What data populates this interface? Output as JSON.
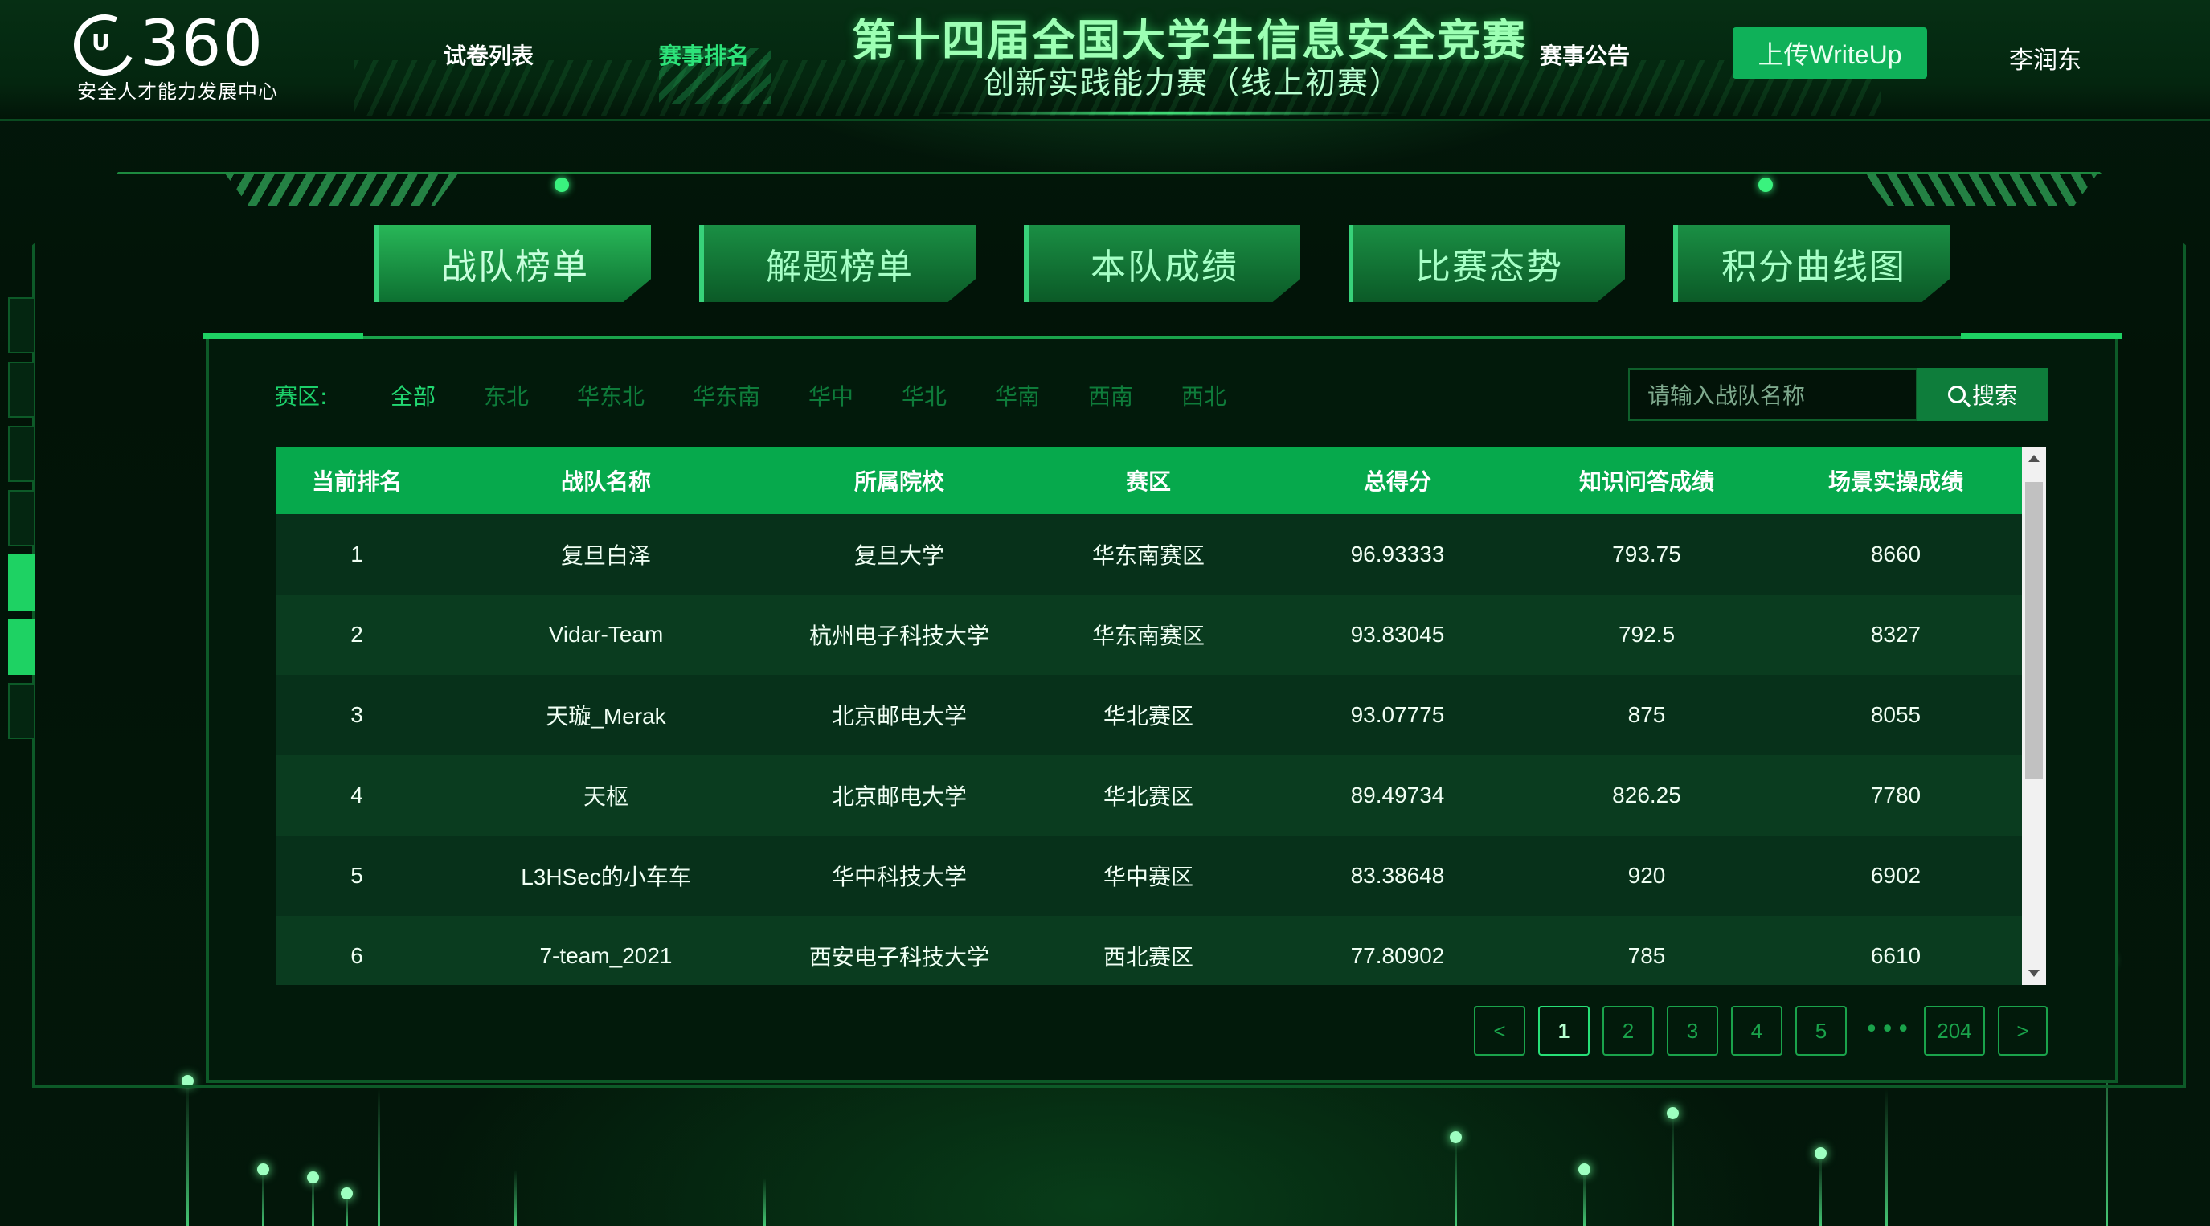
{
  "header": {
    "logo_number": "360",
    "logo_subtitle": "安全人才能力发展中心",
    "nav": [
      "试卷列表",
      "赛事排名",
      "赛事公告"
    ],
    "title_main": "第十四届全国大学生信息安全竞赛",
    "title_sub": "创新实践能力赛（线上初赛）",
    "upload_label": "上传WriteUp",
    "user_name": "李润东"
  },
  "tabs": [
    "战队榜单",
    "解题榜单",
    "本队成绩",
    "比赛态势",
    "积分曲线图"
  ],
  "filter": {
    "label": "赛区:",
    "regions": [
      "全部",
      "东北",
      "华东北",
      "华东南",
      "华中",
      "华北",
      "华南",
      "西南",
      "西北"
    ],
    "search_placeholder": "请输入战队名称",
    "search_label": "搜索"
  },
  "table": {
    "columns": [
      "当前排名",
      "战队名称",
      "所属院校",
      "赛区",
      "总得分",
      "知识问答成绩",
      "场景实操成绩"
    ],
    "rows": [
      [
        "1",
        "复旦白泽",
        "复旦大学",
        "华东南赛区",
        "96.93333",
        "793.75",
        "8660"
      ],
      [
        "2",
        "Vidar-Team",
        "杭州电子科技大学",
        "华东南赛区",
        "93.83045",
        "792.5",
        "8327"
      ],
      [
        "3",
        "天璇_Merak",
        "北京邮电大学",
        "华北赛区",
        "93.07775",
        "875",
        "8055"
      ],
      [
        "4",
        "天枢",
        "北京邮电大学",
        "华北赛区",
        "89.49734",
        "826.25",
        "7780"
      ],
      [
        "5",
        "L3HSec的小车车",
        "华中科技大学",
        "华中赛区",
        "83.38648",
        "920",
        "6902"
      ],
      [
        "6",
        "7-team_2021",
        "西安电子科技大学",
        "西北赛区",
        "77.80902",
        "785",
        "6610"
      ]
    ]
  },
  "pagination": {
    "prev": "<",
    "pages": [
      "1",
      "2",
      "3",
      "4",
      "5"
    ],
    "ellipsis": "•••",
    "last": "204",
    "next": ">"
  },
  "colors": {
    "accent": "#06a94c",
    "active_text": "#2de37a",
    "background": "#021208"
  }
}
